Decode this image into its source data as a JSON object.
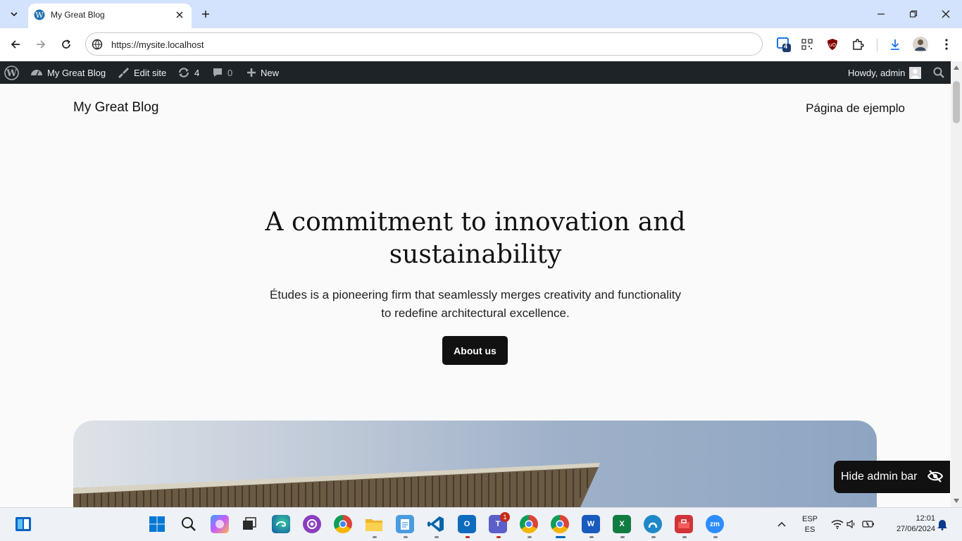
{
  "browser": {
    "tab_title": "My Great Blog",
    "url": "https://mysite.localhost",
    "extension_badge": "4"
  },
  "admin_bar": {
    "site_name": "My Great Blog",
    "edit_site": "Edit site",
    "updates_count": "4",
    "comments_count": "0",
    "new_label": "New",
    "greeting": "Howdy, admin"
  },
  "site": {
    "title": "My Great Blog",
    "nav_link": "Página de ejemplo"
  },
  "hero": {
    "heading": "A commitment to innovation and sustainability",
    "text": "Études is a pioneering firm that seamlessly merges creativity and functionality to redefine architectural excellence.",
    "button": "About us"
  },
  "hide_admin_bar": "Hide admin bar",
  "taskbar": {
    "teams_badge": "1",
    "language": "ESP",
    "language_sub": "ES",
    "time": "12:01",
    "date": "27/06/2024"
  }
}
